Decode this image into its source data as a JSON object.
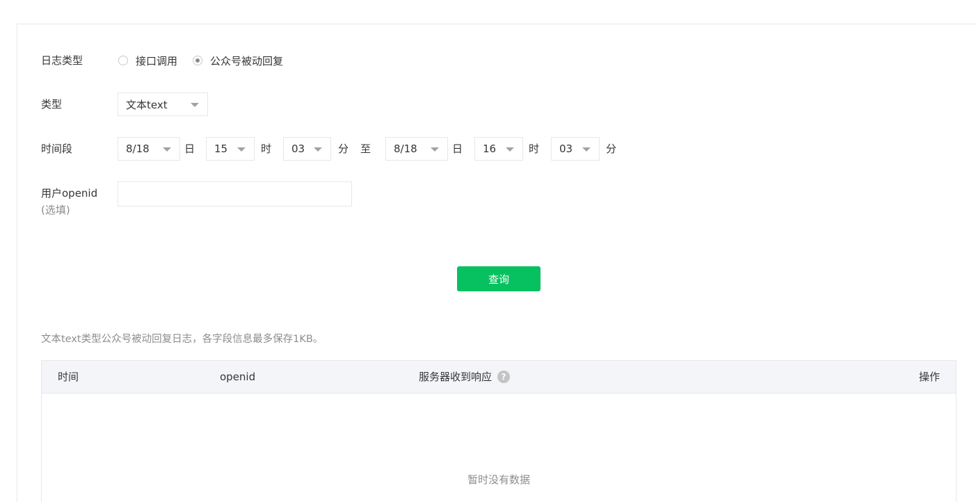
{
  "form": {
    "log_type_label": "日志类型",
    "log_type_options": [
      {
        "label": "接口调用",
        "selected": false
      },
      {
        "label": "公众号被动回复",
        "selected": true
      }
    ],
    "type_label": "类型",
    "type_value": "文本text",
    "period_label": "时间段",
    "start": {
      "date": "8/18",
      "date_unit": "日",
      "hour": "15",
      "hour_unit": "时",
      "minute": "03",
      "minute_unit": "分"
    },
    "to_label": "至",
    "end": {
      "date": "8/18",
      "date_unit": "日",
      "hour": "16",
      "hour_unit": "时",
      "minute": "03",
      "minute_unit": "分"
    },
    "openid_label": "用户openid",
    "openid_sublabel": "(选填)",
    "openid_value": "",
    "query_button": "查询"
  },
  "description": "文本text类型公众号被动回复日志，各字段信息最多保存1KB。",
  "table": {
    "columns": [
      "时间",
      "openid",
      "服务器收到响应",
      "操作"
    ],
    "help_icon_glyph": "?",
    "empty_text": "暂时没有数据"
  },
  "colors": {
    "primary": "#07c160",
    "border": "#e7e7eb",
    "header_bg": "#f4f5f9",
    "muted_text": "#8d8d8d"
  }
}
